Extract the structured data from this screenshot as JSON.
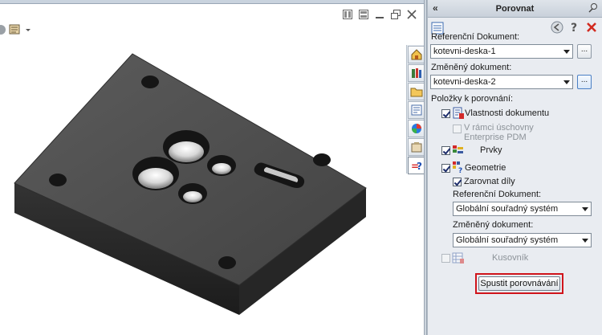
{
  "pane": {
    "title": "Porovnat",
    "collapse_glyph": "«",
    "tool_icons": [
      "task-list-icon",
      "back-icon",
      "help-icon",
      "close-icon"
    ],
    "ref_doc_label": "Referenční Dokument:",
    "ref_doc_value": "kotevni-deska-1",
    "changed_doc_label": "Změněný dokument:",
    "changed_doc_value": "kotevni-deska-2",
    "browse_label": "...",
    "items_label": "Položky k porovnání:",
    "doc_props": {
      "label": "Vlastnosti dokumentu",
      "checked": true
    },
    "enterprise": {
      "label_line1": "V rámci úschovny",
      "label_line2": "Enterprise PDM",
      "checked": false,
      "enabled": false
    },
    "features": {
      "label": "Prvky",
      "checked": true
    },
    "geometry": {
      "label": "Geometrie",
      "checked": true
    },
    "align": {
      "label": "Zarovnat díly",
      "checked": true
    },
    "geo_ref_label": "Referenční Dokument:",
    "geo_ref_value": "Globální souřadný systém",
    "geo_changed_label": "Změněný dokument:",
    "geo_changed_value": "Globální souřadný systém",
    "bom": {
      "label": "Kusovník",
      "checked": false,
      "enabled": false
    },
    "run_button": "Spustit porovnávání"
  },
  "side_tabs": [
    "home-icon",
    "design-library-icon",
    "file-explorer-icon",
    "view-palette-icon",
    "appearances-icon",
    "custom-properties-icon",
    "compare-icon"
  ],
  "viewport": {
    "window_controls": [
      "tile-horizontal-icon",
      "tile-vertical-icon",
      "minimize-icon",
      "restore-icon",
      "close-icon"
    ]
  },
  "colors": {
    "highlight": "#d0141b",
    "part_top": "#4d4d4d",
    "part_side": "#2a2a2a"
  }
}
